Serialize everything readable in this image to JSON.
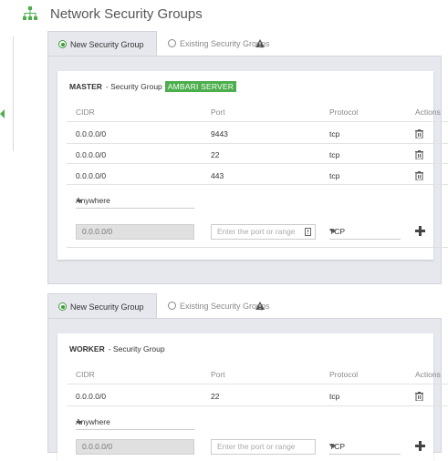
{
  "header": {
    "title": "Network Security Groups",
    "icon": "network-icon"
  },
  "colors": {
    "accent": "#4cae4c",
    "panel_bg": "#e7e8ee"
  },
  "sections": [
    {
      "tabs": {
        "new_label": "New Security Group",
        "existing_label": "Existing Security Groups"
      },
      "group_name": "MASTER",
      "group_suffix": "- Security Group",
      "badge": "AMBARI SERVER",
      "columns": [
        "CIDR",
        "Port",
        "Protocol",
        "Actions"
      ],
      "rows": [
        {
          "cidr": "0.0.0.0/0",
          "port": "9443",
          "protocol": "tcp"
        },
        {
          "cidr": "0.0.0.0/0",
          "port": "22",
          "protocol": "tcp"
        },
        {
          "cidr": "0.0.0.0/0",
          "port": "443",
          "protocol": "tcp"
        }
      ],
      "new_rule": {
        "source": "Anywhere",
        "cidr_value": "0.0.0.0/0",
        "port_placeholder": "Enter the port or range",
        "protocol": "TCP"
      }
    },
    {
      "tabs": {
        "new_label": "New Security Group",
        "existing_label": "Existing Security Groups"
      },
      "group_name": "WORKER",
      "group_suffix": "- Security Group",
      "badge": "",
      "columns": [
        "CIDR",
        "Port",
        "Protocol",
        "Actions"
      ],
      "rows": [
        {
          "cidr": "0.0.0.0/0",
          "port": "22",
          "protocol": "tcp"
        }
      ],
      "new_rule": {
        "source": "Anywhere",
        "cidr_value": "0.0.0.0/0",
        "port_placeholder": "Enter the port or range",
        "protocol": "TCP"
      }
    }
  ]
}
